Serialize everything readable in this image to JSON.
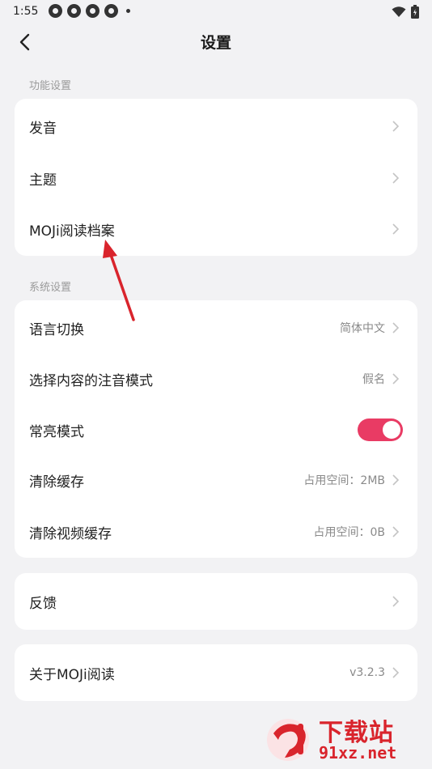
{
  "status_bar": {
    "time": "1:55"
  },
  "header": {
    "title": "设置"
  },
  "sections": {
    "function_label": "功能设置",
    "system_label": "系统设置"
  },
  "function_items": [
    {
      "label": "发音"
    },
    {
      "label": "主题"
    },
    {
      "label": "MOJi阅读档案"
    }
  ],
  "system_items": [
    {
      "label": "语言切换",
      "value": "简体中文"
    },
    {
      "label": "选择内容的注音模式",
      "value": "假名"
    },
    {
      "label": "常亮模式",
      "toggle_on": true
    },
    {
      "label": "清除缓存",
      "value": "占用空间：2MB"
    },
    {
      "label": "清除视频缓存",
      "value": "占用空间：0B"
    }
  ],
  "feedback": {
    "label": "反馈"
  },
  "about": {
    "label": "关于MOJi阅读",
    "value": "v3.2.3"
  },
  "colors": {
    "accent": "#e93b64",
    "annotation_arrow": "#d9242c"
  },
  "watermark": {
    "line1": "下载站",
    "line2": "91xz.net"
  }
}
